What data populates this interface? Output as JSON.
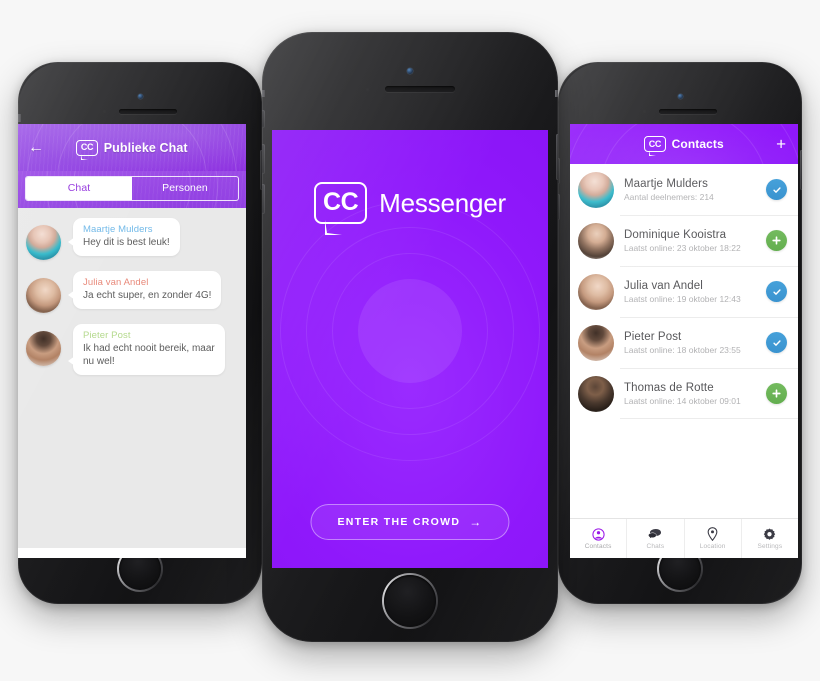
{
  "brand": {
    "logo_text": "CC",
    "name": "Messenger",
    "accent_purple": "#8C14FA",
    "header_purple": "#9140E2",
    "check_blue": "#3E9BD6",
    "plus_green": "#67B356",
    "page_background": "#F7F7F7"
  },
  "left_phone": {
    "header": {
      "back_icon": "back-arrow-icon",
      "logo_text": "CC",
      "title": "Publieke Chat"
    },
    "tabs": [
      {
        "label": "Chat",
        "active": true
      },
      {
        "label": "Personen",
        "active": false
      }
    ],
    "messages": [
      {
        "name": "Maartje Mulders",
        "name_color": "#6FB8E8",
        "text": "Hey dit is best leuk!",
        "avatar": "avatar-maartje"
      },
      {
        "name": "Julia van Andel",
        "name_color": "#E8897A",
        "text": "Ja echt super, en zonder 4G!",
        "avatar": "avatar-julia"
      },
      {
        "name": "Pieter Post",
        "name_color": "#B4D98C",
        "text": "Ik had echt nooit bereik, maar nu wel!",
        "avatar": "avatar-pieter"
      }
    ]
  },
  "center_phone": {
    "splash": {
      "logo_text": "CC",
      "title": "Messenger",
      "cta_label": "ENTER THE CROWD",
      "cta_arrow": "→"
    }
  },
  "right_phone": {
    "header": {
      "logo_text": "CC",
      "title": "Contacts",
      "add_label": "+"
    },
    "contacts": [
      {
        "name": "Maartje Mulders",
        "subtitle": "Aantal deelnemers: 214",
        "action": "check",
        "avatar": "avatar-maartje"
      },
      {
        "name": "Dominique Kooistra",
        "subtitle": "Laatst online: 23 oktober 18:22",
        "action": "plus",
        "avatar": "avatar-dominique"
      },
      {
        "name": "Julia van Andel",
        "subtitle": "Laatst online: 19 oktober 12:43",
        "action": "check",
        "avatar": "avatar-julia"
      },
      {
        "name": "Pieter Post",
        "subtitle": "Laatst online: 18 oktober 23:55",
        "action": "check",
        "avatar": "avatar-pieter"
      },
      {
        "name": "Thomas de Rotte",
        "subtitle": "Laatst online: 14 oktober 09:01",
        "action": "plus",
        "avatar": "avatar-thomas"
      }
    ],
    "tabbar": [
      {
        "label": "Contacts",
        "icon": "person-circle-icon",
        "active": true
      },
      {
        "label": "Chats",
        "icon": "chat-bubbles-icon",
        "active": false
      },
      {
        "label": "Location",
        "icon": "map-pin-icon",
        "active": false
      },
      {
        "label": "Settings",
        "icon": "gear-icon",
        "active": false
      }
    ]
  }
}
